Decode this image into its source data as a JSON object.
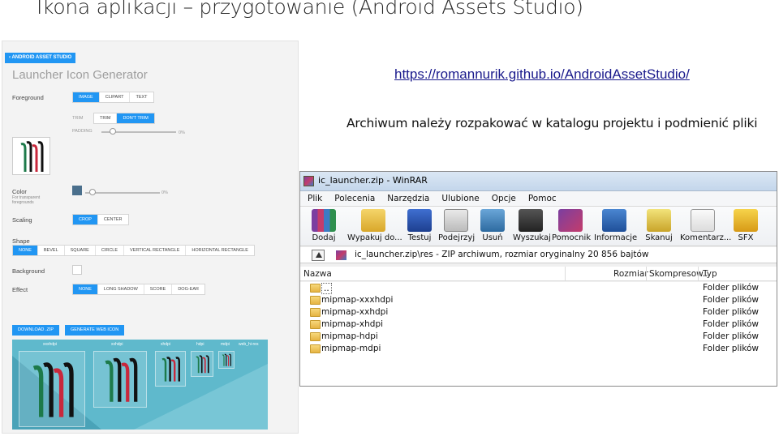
{
  "slide": {
    "title": "Ikona aplikacji – przygotowanie (Android Assets Studio)",
    "link": "https://romannurik.github.io/AndroidAssetStudio/",
    "instruction": "Archiwum należy rozpakować w katalogu projektu i podmienić pliki"
  },
  "asset_studio": {
    "back_label": "‹ ANDROID ASSET STUDIO",
    "heading": "Launcher Icon Generator",
    "foreground_label": "Foreground",
    "foreground_options": [
      "IMAGE",
      "CLIPART",
      "TEXT"
    ],
    "foreground_active": "IMAGE",
    "trim_label": "TRIM",
    "trim_options": [
      "TRIM",
      "DON'T TRIM"
    ],
    "trim_active": "DON'T TRIM",
    "padding_label": "PADDING",
    "padding_value": "0%",
    "padding_level": 0.15,
    "color_label": "Color",
    "color_sublabel": "For transparent foregrounds",
    "color_value": "0%",
    "color_swatch": "#4a6f8c",
    "color_level": 0.1,
    "scaling_label": "Scaling",
    "scaling_options": [
      "CROP",
      "CENTER"
    ],
    "scaling_active": "CROP",
    "shape_label": "Shape",
    "shape_options": [
      "NONE",
      "BEVEL",
      "SQUARE",
      "CIRCLE",
      "VERTICAL RECTANGLE",
      "HORIZONTAL RECTANGLE"
    ],
    "shape_active": "NONE",
    "background_label": "Background",
    "effect_label": "Effect",
    "effect_options": [
      "NONE",
      "LONG SHADOW",
      "SCORE",
      "DOG-EAR"
    ],
    "effect_active": "NONE",
    "download_label": "DOWNLOAD .ZIP",
    "generate_label": "GENERATE WEB ICON",
    "densities": [
      "xxxhdpi",
      "xxhdpi",
      "xhdpi",
      "hdpi",
      "mdpi",
      "web_hi-res"
    ],
    "accent_color": "#2196f3"
  },
  "winrar": {
    "title": "ic_launcher.zip - WinRAR",
    "menu": [
      "Plik",
      "Polecenia",
      "Narzędzia",
      "Ulubione",
      "Opcje",
      "Pomoc"
    ],
    "toolbar": [
      {
        "label": "Dodaj",
        "icon": "add-books-icon"
      },
      {
        "label": "Wypakuj do...",
        "icon": "extract-folder-icon"
      },
      {
        "label": "Testuj",
        "icon": "test-check-icon"
      },
      {
        "label": "Podejrzyj",
        "icon": "view-glasses-icon"
      },
      {
        "label": "Usuń",
        "icon": "delete-recycle-icon"
      },
      {
        "label": "Wyszukaj",
        "icon": "find-binoculars-icon"
      },
      {
        "label": "Pomocnik",
        "icon": "wizard-icon"
      },
      {
        "label": "Informacje",
        "icon": "info-icon"
      },
      {
        "label": "Skanuj",
        "icon": "scan-virus-icon"
      },
      {
        "label": "Komentarz...",
        "icon": "comment-icon"
      },
      {
        "label": "SFX",
        "icon": "sfx-star-icon"
      }
    ],
    "path": "ic_launcher.zip\\res - ZIP archiwum, rozmiar oryginalny 20 856 bajtów",
    "columns": [
      "Nazwa",
      "Rozmiar",
      "Skompresow...",
      "Typ"
    ],
    "rows": [
      {
        "name": "..",
        "type": "Folder plików"
      },
      {
        "name": "mipmap-xxxhdpi",
        "type": "Folder plików"
      },
      {
        "name": "mipmap-xxhdpi",
        "type": "Folder plików"
      },
      {
        "name": "mipmap-xhdpi",
        "type": "Folder plików"
      },
      {
        "name": "mipmap-hdpi",
        "type": "Folder plików"
      },
      {
        "name": "mipmap-mdpi",
        "type": "Folder plików"
      }
    ]
  }
}
